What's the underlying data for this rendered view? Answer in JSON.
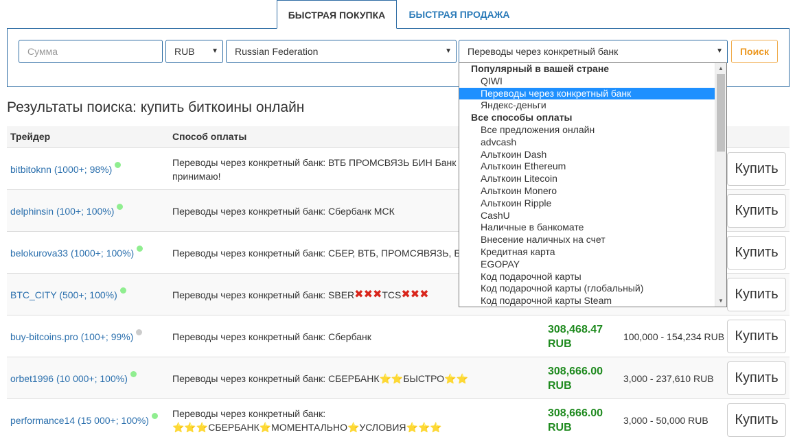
{
  "tabs": {
    "buy": "БЫСТРАЯ ПОКУПКА",
    "sell": "БЫСТРАЯ ПРОДАЖА"
  },
  "search": {
    "amount_placeholder": "Сумма",
    "currency": "RUB",
    "country": "Russian Federation",
    "payment_method": "Переводы через конкретный банк",
    "button": "Поиск"
  },
  "page_title": "Результаты поиска: купить биткоины онлайн",
  "table": {
    "headers": {
      "trader": "Трейдер",
      "payment": "Способ оплаты"
    },
    "buy_label": "Купить",
    "rows": [
      {
        "trader": "bitbitoknn (1000+; 98%)",
        "status": "online",
        "payment": "Переводы через конкретный банк: ВТБ ПРОМСВЯЗЬ БИН Банк\nпринимаю!",
        "price": "",
        "limit": ""
      },
      {
        "trader": "delphinsin (100+; 100%)",
        "status": "online",
        "payment": "Переводы через конкретный банк: Сбербанк МСК",
        "price": "",
        "limit": ""
      },
      {
        "trader": "belokurova33 (1000+; 100%)",
        "status": "online",
        "payment": "Переводы через конкретный банк: СБЕР, ВТБ, ПРОМСЯВЯЗЬ, Б",
        "price": "",
        "limit": ""
      },
      {
        "trader": "BTC_CITY (500+; 100%)",
        "status": "online",
        "payment": "Переводы через конкретный банк: SBER ✖✖✖ TCS ✖✖✖",
        "price": "",
        "limit": ""
      },
      {
        "trader": "buy-bitcoins.pro (100+; 99%)",
        "status": "offline",
        "payment": "Переводы через конкретный банк: Сбербанк",
        "price": "308,468.47\nRUB",
        "limit": "100,000 - 154,234\nRUB"
      },
      {
        "trader": "orbet1996 (10 000+; 100%)",
        "status": "online",
        "payment": "Переводы через конкретный банк: СБЕРБАНК⭐⭐БЫСТРО⭐⭐",
        "price": "308,666.00\nRUB",
        "limit": "3,000 - 237,610 RUB"
      },
      {
        "trader": "performance14 (15 000+; 100%)",
        "status": "online",
        "payment": "Переводы через конкретный банк:\n⭐⭐⭐СБЕРБАНК⭐МОМЕНТАЛЬНО⭐УСЛОВИЯ⭐⭐⭐",
        "price": "308,666.00\nRUB",
        "limit": "3,000 - 50,000 RUB"
      }
    ]
  },
  "dropdown": {
    "items": [
      {
        "label": "Популярный в вашей стране",
        "group": true
      },
      {
        "label": "QIWI"
      },
      {
        "label": "Переводы через конкретный банк",
        "selected": true
      },
      {
        "label": "Яндекс-деньги"
      },
      {
        "label": "Все способы оплаты",
        "group": true
      },
      {
        "label": "Все предложения онлайн"
      },
      {
        "label": "advcash"
      },
      {
        "label": "Альткоин Dash"
      },
      {
        "label": "Альткоин Ethereum"
      },
      {
        "label": "Альткоин Litecoin"
      },
      {
        "label": "Альткоин Monero"
      },
      {
        "label": "Альткоин Ripple"
      },
      {
        "label": "CashU"
      },
      {
        "label": "Наличные в банкомате"
      },
      {
        "label": "Внесение наличных на счет"
      },
      {
        "label": "Кредитная карта"
      },
      {
        "label": "EGOPAY"
      },
      {
        "label": "Код подарочной карты"
      },
      {
        "label": "Код подарочной карты (глобальный)"
      },
      {
        "label": "Код подарочной карты Steam"
      }
    ]
  },
  "colors": {
    "accent": "#2e6da4",
    "link": "#2a6fad",
    "price": "#1e8a1e",
    "online": "#90ee90",
    "offline": "#cccccc",
    "search_button": "#ec971f",
    "selected": "#1e90ff"
  }
}
